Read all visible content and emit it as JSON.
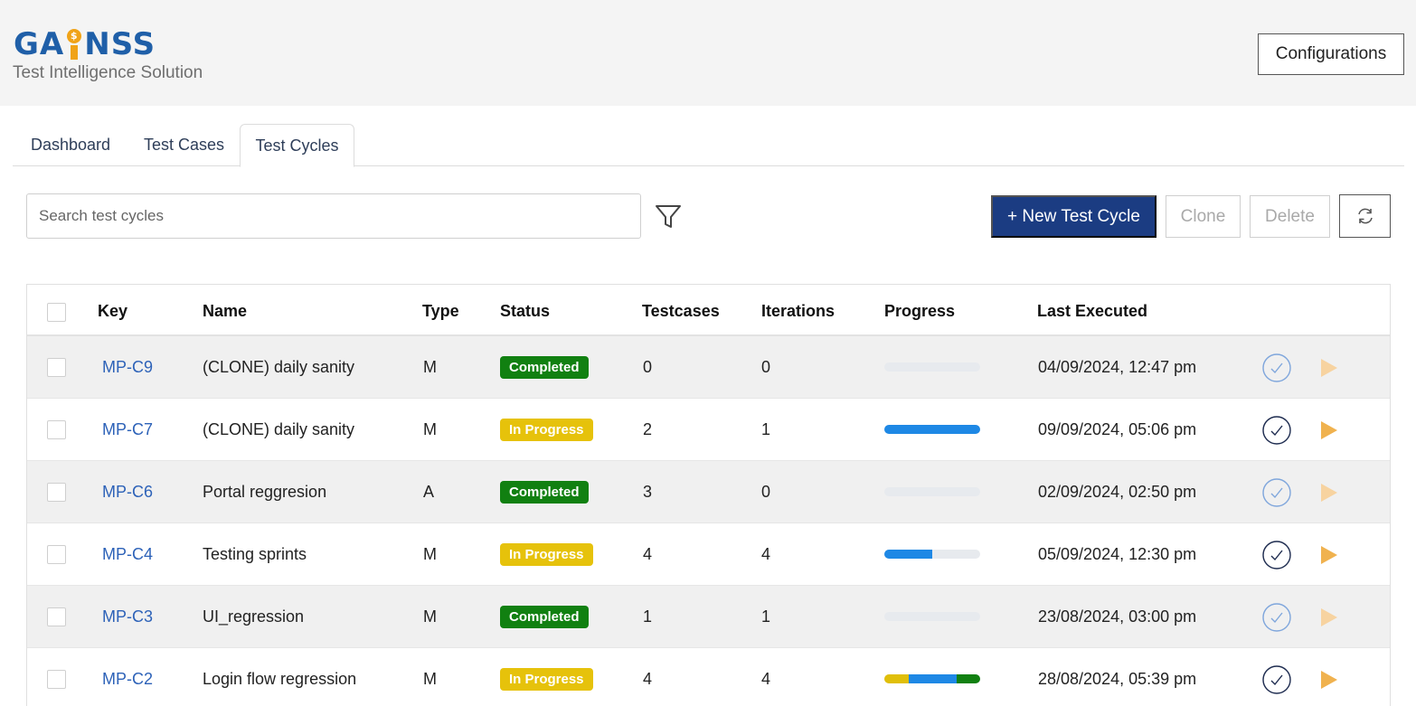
{
  "header": {
    "logo_text": "GAINSS",
    "subtitle": "Test Intelligence Solution",
    "config_button": "Configurations"
  },
  "tabs": [
    {
      "label": "Dashboard",
      "active": false
    },
    {
      "label": "Test Cases",
      "active": false
    },
    {
      "label": "Test Cycles",
      "active": true
    }
  ],
  "toolbar": {
    "search_placeholder": "Search test cycles",
    "search_value": "",
    "filter_icon": "filter-icon",
    "new_button": "+ New Test Cycle",
    "clone_button": "Clone",
    "delete_button": "Delete",
    "refresh_icon": "refresh-icon"
  },
  "table": {
    "columns": [
      "Key",
      "Name",
      "Type",
      "Status",
      "Testcases",
      "Iterations",
      "Progress",
      "Last Executed"
    ],
    "rows": [
      {
        "key": "MP-C9",
        "name": "(CLONE) daily sanity",
        "type": "M",
        "status": "Completed",
        "testcases": "0",
        "iterations": "0",
        "last_executed": "04/09/2024, 12:47 pm",
        "progress": [],
        "actions_enabled": false
      },
      {
        "key": "MP-C7",
        "name": "(CLONE) daily sanity",
        "type": "M",
        "status": "In Progress",
        "testcases": "2",
        "iterations": "1",
        "last_executed": "09/09/2024, 05:06 pm",
        "progress": [
          {
            "color": "#1e88e5",
            "fraction": 1.0
          }
        ],
        "actions_enabled": true
      },
      {
        "key": "MP-C6",
        "name": "Portal reggresion",
        "type": "A",
        "status": "Completed",
        "testcases": "3",
        "iterations": "0",
        "last_executed": "02/09/2024, 02:50 pm",
        "progress": [],
        "actions_enabled": false
      },
      {
        "key": "MP-C4",
        "name": "Testing sprints",
        "type": "M",
        "status": "In Progress",
        "testcases": "4",
        "iterations": "4",
        "last_executed": "05/09/2024, 12:30 pm",
        "progress": [
          {
            "color": "#1e88e5",
            "fraction": 0.5
          }
        ],
        "actions_enabled": true
      },
      {
        "key": "MP-C3",
        "name": "UI_regression",
        "type": "M",
        "status": "Completed",
        "testcases": "1",
        "iterations": "1",
        "last_executed": "23/08/2024, 03:00 pm",
        "progress": [],
        "actions_enabled": false
      },
      {
        "key": "MP-C2",
        "name": "Login flow regression",
        "type": "M",
        "status": "In Progress",
        "testcases": "4",
        "iterations": "4",
        "last_executed": "28/08/2024, 05:39 pm",
        "progress": [
          {
            "color": "#e0bf0a",
            "fraction": 0.25
          },
          {
            "color": "#1e88e5",
            "fraction": 0.5
          },
          {
            "color": "#118011",
            "fraction": 0.25
          }
        ],
        "actions_enabled": true
      }
    ]
  },
  "colors": {
    "primary": "#1b3c82",
    "completed": "#118011",
    "in_progress": "#e6c20b",
    "link": "#2d62b8",
    "play": "#f0b24f"
  }
}
